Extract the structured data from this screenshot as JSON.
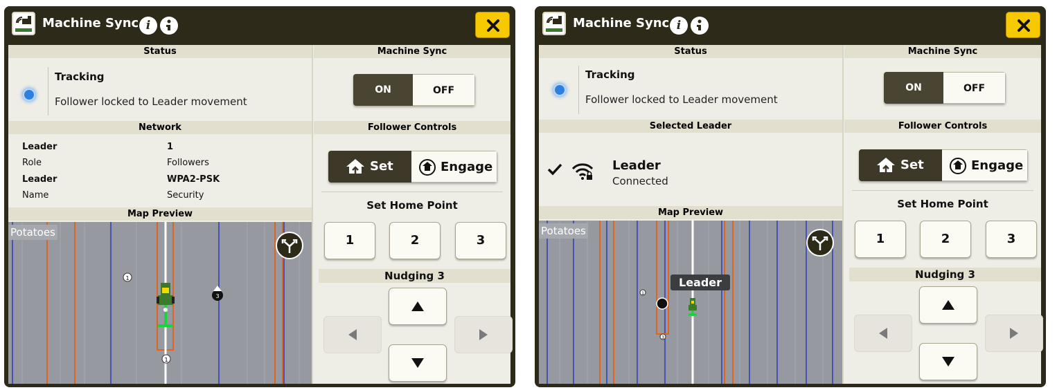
{
  "colors": {
    "accent": "#f7c900",
    "brand_green": "#367c2b",
    "frame": "#2e2a1a"
  },
  "panels": [
    {
      "title": "Machine Sync",
      "status": {
        "header": "Status",
        "state": "Tracking",
        "detail": "Follower locked to Leader movement"
      },
      "machine_sync": {
        "header": "Machine Sync",
        "on_label": "ON",
        "off_label": "OFF",
        "selected": "ON"
      },
      "network": {
        "header": "Network",
        "rows": [
          {
            "label": "Leader",
            "value": "1"
          },
          {
            "label": "Role",
            "value": "Followers"
          },
          {
            "label": "Leader",
            "value": "WPA2-PSK"
          },
          {
            "label": "Name",
            "value": "Security"
          }
        ]
      },
      "follower_controls": {
        "header": "Follower Controls",
        "set_label": "Set",
        "engage_label": "Engage",
        "home_header": "Set Home Point",
        "home_points": [
          "1",
          "2",
          "3"
        ],
        "nudging_label": "Nudging 3"
      },
      "map": {
        "header": "Map Preview",
        "field": "Potatoes",
        "markers": [
          "1",
          "3",
          "1"
        ]
      }
    },
    {
      "title": "Machine Sync",
      "status": {
        "header": "Status",
        "state": "Tracking",
        "detail": "Follower locked to Leader movement"
      },
      "machine_sync": {
        "header": "Machine Sync",
        "on_label": "ON",
        "off_label": "OFF",
        "selected": "ON"
      },
      "selected_leader": {
        "header": "Selected Leader",
        "name": "Leader",
        "state": "Connected"
      },
      "follower_controls": {
        "header": "Follower Controls",
        "set_label": "Set",
        "engage_label": "Engage",
        "home_header": "Set Home Point",
        "home_points": [
          "1",
          "2",
          "3"
        ],
        "nudging_label": "Nudging 3"
      },
      "map": {
        "header": "Map Preview",
        "field": "Potatoes",
        "leader_tag": "Leader",
        "markers": [
          "1",
          "3"
        ]
      }
    }
  ]
}
